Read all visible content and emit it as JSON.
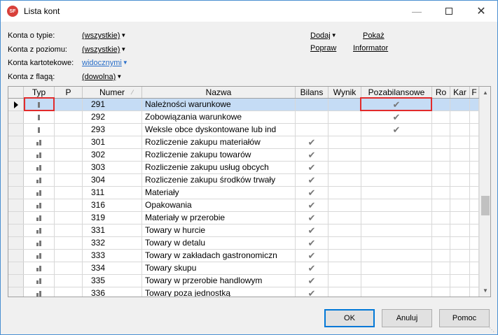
{
  "window": {
    "title": "Lista kont",
    "app_icon_text": "SF"
  },
  "filters": [
    {
      "label": "Konta o typie:",
      "value": "(wszystkie)",
      "blue": false
    },
    {
      "label": "Konta z poziomu:",
      "value": "(wszystkie)",
      "blue": false
    },
    {
      "label": "Konta kartotekowe:",
      "value": "widocznymi",
      "blue": true
    },
    {
      "label": "Konta z flagą:",
      "value": "(dowolna)",
      "blue": false
    }
  ],
  "actions": {
    "dodaj": "Dodaj",
    "pokaz": "Pokaż",
    "popraw": "Popraw",
    "informator": "Informator"
  },
  "columns": [
    "Typ",
    "P",
    "Numer",
    "Nazwa",
    "Bilans",
    "Wynik",
    "Pozabilansowe",
    "Ro",
    "Kar",
    "F"
  ],
  "rows": [
    {
      "typ": "single",
      "numer": "291",
      "nazwa": "Należności warunkowe",
      "bilans": false,
      "poza": true,
      "selected": true
    },
    {
      "typ": "single",
      "numer": "292",
      "nazwa": "Zobowiązania warunkowe",
      "bilans": false,
      "poza": true,
      "selected": false
    },
    {
      "typ": "single",
      "numer": "293",
      "nazwa": "Weksle obce dyskontowane lub ind",
      "bilans": false,
      "poza": true,
      "selected": false
    },
    {
      "typ": "double",
      "numer": "301",
      "nazwa": "Rozliczenie zakupu materiałów",
      "bilans": true,
      "poza": false,
      "selected": false
    },
    {
      "typ": "double",
      "numer": "302",
      "nazwa": "Rozliczenie zakupu towarów",
      "bilans": true,
      "poza": false,
      "selected": false
    },
    {
      "typ": "double",
      "numer": "303",
      "nazwa": "Rozliczenie zakupu usług obcych",
      "bilans": true,
      "poza": false,
      "selected": false
    },
    {
      "typ": "double",
      "numer": "304",
      "nazwa": "Rozliczenie zakupu środków trwały",
      "bilans": true,
      "poza": false,
      "selected": false
    },
    {
      "typ": "double",
      "numer": "311",
      "nazwa": "Materiały",
      "bilans": true,
      "poza": false,
      "selected": false
    },
    {
      "typ": "double",
      "numer": "316",
      "nazwa": "Opakowania",
      "bilans": true,
      "poza": false,
      "selected": false
    },
    {
      "typ": "double",
      "numer": "319",
      "nazwa": "Materiały w przerobie",
      "bilans": true,
      "poza": false,
      "selected": false
    },
    {
      "typ": "double",
      "numer": "331",
      "nazwa": "Towary w hurcie",
      "bilans": true,
      "poza": false,
      "selected": false
    },
    {
      "typ": "double",
      "numer": "332",
      "nazwa": "Towary w detalu",
      "bilans": true,
      "poza": false,
      "selected": false
    },
    {
      "typ": "double",
      "numer": "333",
      "nazwa": "Towary w zakładach gastronomiczn",
      "bilans": true,
      "poza": false,
      "selected": false
    },
    {
      "typ": "double",
      "numer": "334",
      "nazwa": "Towary skupu",
      "bilans": true,
      "poza": false,
      "selected": false
    },
    {
      "typ": "double",
      "numer": "335",
      "nazwa": "Towary w przerobie handlowym",
      "bilans": true,
      "poza": false,
      "selected": false
    },
    {
      "typ": "double",
      "numer": "336",
      "nazwa": "Towary poza jednostką",
      "bilans": true,
      "poza": false,
      "selected": false
    }
  ],
  "buttons": {
    "ok": "OK",
    "anuluj": "Anuluj",
    "pomoc": "Pomoc"
  },
  "icons": {
    "check": "check-icon",
    "dropdown": "dropdown-triangle-icon",
    "sort": "sort-indicator-icon",
    "row_pointer": "row-pointer-icon"
  },
  "colors": {
    "selected_row": "#c5dcf5",
    "highlight": "#e22b2b",
    "link_blue": "#2a6fc9"
  }
}
